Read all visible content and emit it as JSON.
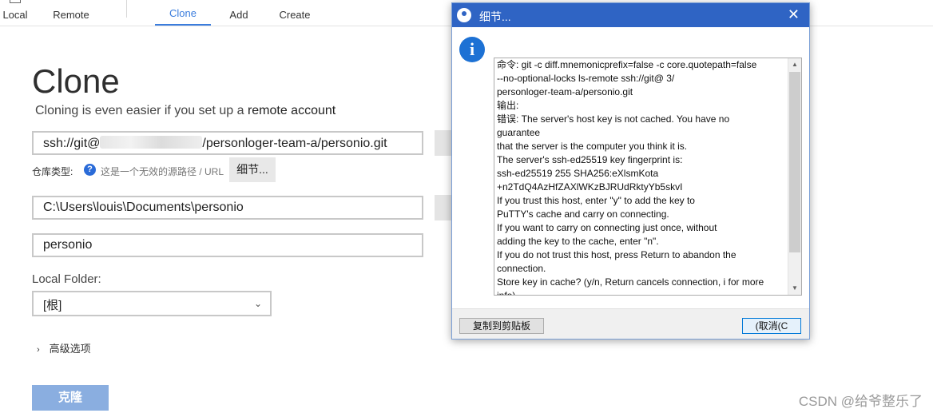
{
  "toolbar": {
    "items": [
      {
        "label": "Local"
      },
      {
        "label": "Remote"
      },
      {
        "label": "Clone"
      },
      {
        "label": "Add"
      },
      {
        "label": "Create"
      }
    ],
    "active": "Clone"
  },
  "clone_page": {
    "title": "Clone",
    "subtitle_prefix": "Cloning is even easier if you set up a",
    "subtitle_link": "remote account",
    "url_prefix": "ssh://git@",
    "url_suffix": "/personloger-team-a/personio.git",
    "repo_type_label": "仓库类型:",
    "help_icon_glyph": "?",
    "invalid_path_text": "这是一个无效的源路径 / URL",
    "details_button": "细节...",
    "destination_path": "C:\\Users\\louis\\Documents\\personio",
    "name_value": "personio",
    "local_folder_label": "Local Folder:",
    "local_folder_value": "[根]",
    "advanced_options": "高级选项",
    "clone_button": "克隆"
  },
  "dialog": {
    "title": "细节...",
    "close_glyph": "✕",
    "info_glyph": "i",
    "lines": [
      "命令: git -c diff.mnemonicprefix=false -c core.quotepath=false",
      "--no-optional-locks ls-remote ssh://git@              3/",
      "personloger-team-a/personio.git",
      "输出:",
      "错误: The server's host key is not cached. You have no",
      "guarantee",
      "that the server is the computer you think it is.",
      "The server's ssh-ed25519 key fingerprint is:",
      "ssh-ed25519 255 SHA256:eXlsmKota",
      "+n2TdQ4AzHfZAXlWKzBJRUdRktyYb5skvI",
      "If you trust this host, enter \"y\" to add the key to",
      "PuTTY's cache and carry on connecting.",
      "If you want to carry on connecting just once, without",
      "adding the key to the cache, enter \"n\".",
      "If you do not trust this host, press Return to abandon the",
      "connection.",
      "Store key in cache? (y/n, Return cancels connection, i for more",
      "info)"
    ],
    "copy_button": "复制到剪贴板",
    "cancel_button": "(取消(C"
  },
  "watermark": "CSDN @给爷整乐了",
  "colors": {
    "accent": "#3b7ddd",
    "dialog_title_bar": "#2f64c4",
    "clone_button": "#8aaee0"
  }
}
